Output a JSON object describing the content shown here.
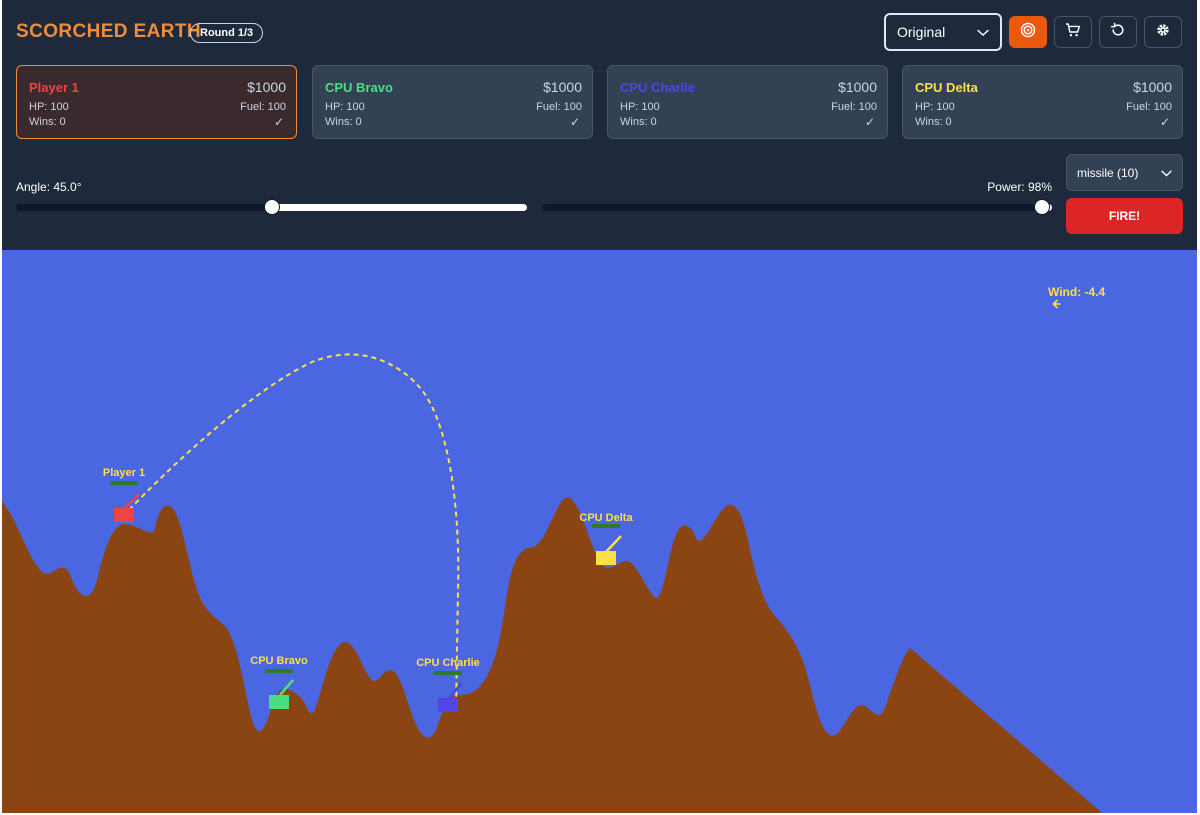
{
  "app": {
    "title": "SCORCHED EARTH",
    "round": "Round 1/3"
  },
  "toolbar": {
    "mode_selected": "Original",
    "buttons": [
      {
        "icon": "target-icon",
        "active": true
      },
      {
        "icon": "cart-icon",
        "active": false
      },
      {
        "icon": "restart-icon",
        "active": false
      },
      {
        "icon": "gear-icon",
        "active": false
      }
    ]
  },
  "players": [
    {
      "name": "Player 1",
      "money": "$1000",
      "hp": "HP: 100",
      "fuel": "Fuel: 100",
      "wins": "Wins: 0",
      "status": "✓",
      "color": "#ef4444",
      "current": true
    },
    {
      "name": "CPU Bravo",
      "money": "$1000",
      "hp": "HP: 100",
      "fuel": "Fuel: 100",
      "wins": "Wins: 0",
      "status": "✓",
      "color": "#4ade80",
      "current": false
    },
    {
      "name": "CPU Charlie",
      "money": "$1000",
      "hp": "HP: 100",
      "fuel": "Fuel: 100",
      "wins": "Wins: 0",
      "status": "✓",
      "color": "#4f46e5",
      "current": false
    },
    {
      "name": "CPU Delta",
      "money": "$1000",
      "hp": "HP: 100",
      "fuel": "Fuel: 100",
      "wins": "Wins: 0",
      "status": "✓",
      "color": "#fde047",
      "current": false
    }
  ],
  "controls": {
    "angle_label": "Angle: 45.0°",
    "angle_value": 45.0,
    "power_label": "Power: 98%",
    "power_value": 98,
    "weapon_selected": "missile (10)",
    "fire_label": "FIRE!"
  },
  "battlefield": {
    "sky_color": "#4a66e0",
    "ground_color": "#8b4513",
    "trail_color": "#fde047",
    "wind_label": "Wind: -4.4",
    "wind_value": -4.4,
    "tanks": [
      {
        "name": "Player 1",
        "color": "#ef4444",
        "hp": 100
      },
      {
        "name": "CPU Bravo",
        "color": "#4ade80",
        "hp": 100
      },
      {
        "name": "CPU Charlie",
        "color": "#4f46e5",
        "hp": 100
      },
      {
        "name": "CPU Delta",
        "color": "#fde047",
        "hp": 100
      }
    ]
  }
}
